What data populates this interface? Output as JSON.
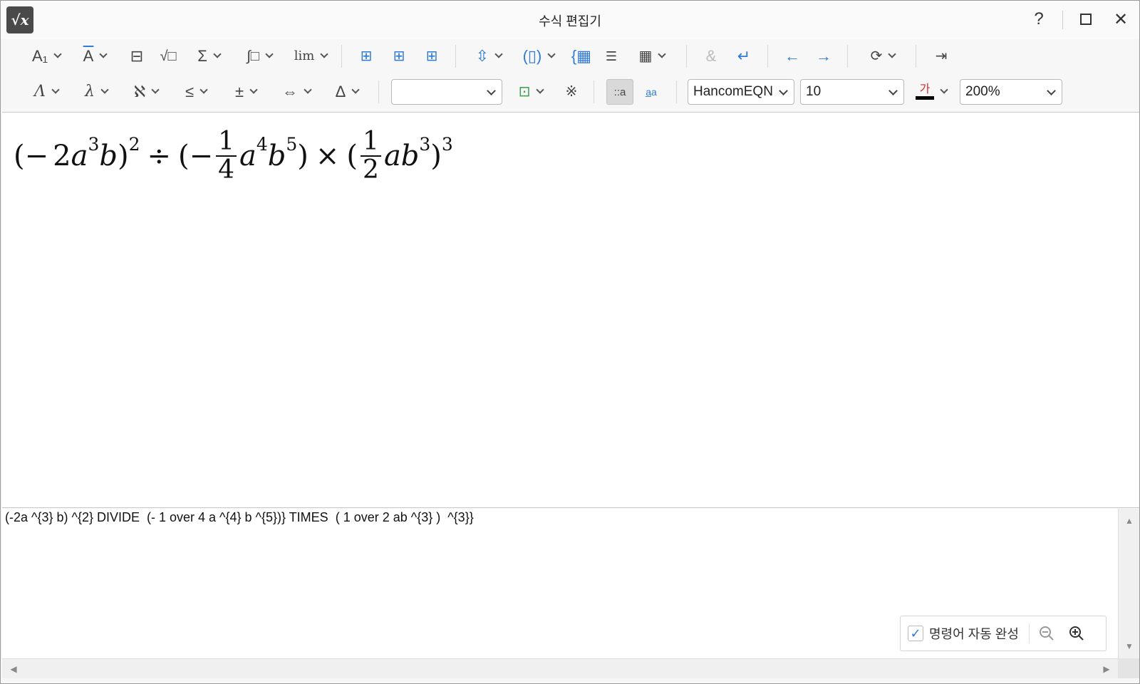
{
  "window": {
    "title": "수식 편집기",
    "logo_text": "√x",
    "help_label": "?",
    "close_label": "✕"
  },
  "toolbar1": {
    "sub_sup_label": "A₁",
    "decoration_label": "A",
    "fraction_label": "⊟",
    "root_label": "√□",
    "sum_label": "Σ",
    "integral_label": "∫□",
    "limit_label": "lim",
    "ampersand_label": "&",
    "enter_label": "↵",
    "back_label": "←",
    "forward_label": "→"
  },
  "toolbar2": {
    "greek_upper_label": "Λ",
    "greek_lower_label": "λ",
    "hebrew_label": "ℵ",
    "relation_label": "≤",
    "plusminus_label": "±",
    "arrow_label": "⇔",
    "misc_label": "Δ",
    "style_combo_value": "",
    "font_combo_value": "HancomEQN",
    "size_combo_value": "10",
    "color_label": "가",
    "color_swatch": "#000000",
    "zoom_combo_value": "200%"
  },
  "formula": {
    "lparen1": "(−",
    "coef1": "2",
    "var_a1": "a",
    "exp_a1": "3",
    "var_b1": "b",
    "rparen1": ")",
    "exp_outer1": "2",
    "divide": "÷",
    "lparen2": "(−",
    "frac1_num": "1",
    "frac1_den": "4",
    "var_a2": "a",
    "exp_a2": "4",
    "var_b2": "b",
    "exp_b2": "5",
    "rparen2": ")",
    "times": "×",
    "lparen3": "(",
    "frac2_num": "1",
    "frac2_den": "2",
    "var_ab3": "ab",
    "exp_b3": "3",
    "rparen3": ")",
    "exp_outer3": "3"
  },
  "script": {
    "text": "(-2a ^{3} b) ^{2} DIVIDE  (- 1 over 4 a ^{4} b ^{5})} TIMES  ( 1 over 2 ab ^{3} )  ^{3}}"
  },
  "autocomplete": {
    "checked": true,
    "label": "명령어 자동 완성"
  },
  "colors": {
    "accent": "#2f7bd6",
    "green": "#3aa04a"
  }
}
